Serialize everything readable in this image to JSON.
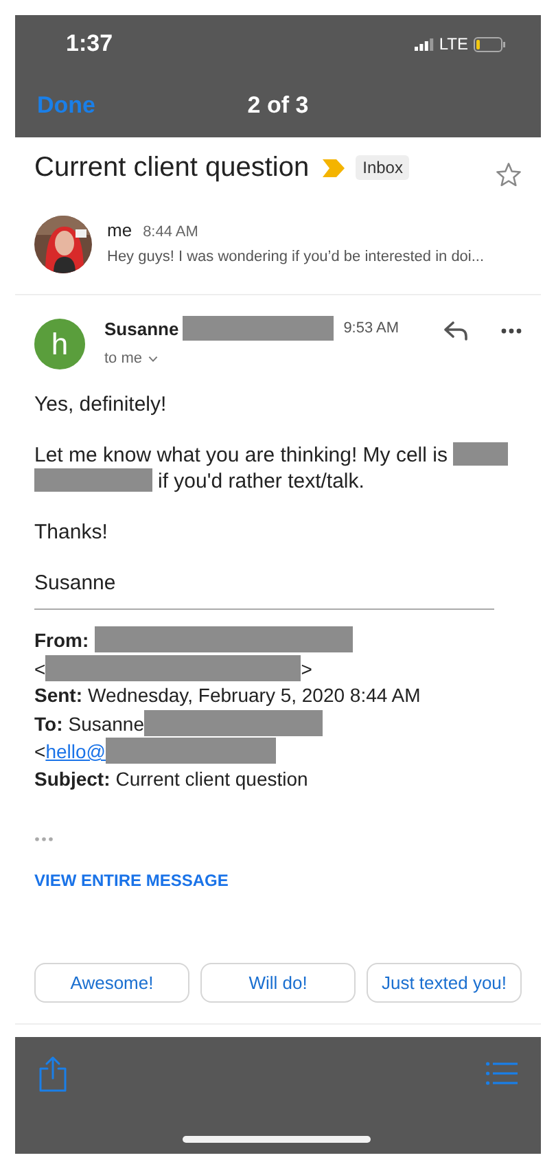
{
  "status_bar": {
    "time": "1:37",
    "network": "LTE"
  },
  "nav": {
    "done": "Done",
    "position": "2 of 3"
  },
  "thread": {
    "subject": "Current client question",
    "important": true,
    "label": "Inbox",
    "starred": false
  },
  "messages": [
    {
      "kind": "collapsed",
      "sender": "me",
      "time": "8:44 AM",
      "snippet": "Hey guys! I was wondering if you’d be interested in doi..."
    },
    {
      "kind": "expanded",
      "sender": "Susanne",
      "avatar_letter": "h",
      "color": "#5a9e3c",
      "time": "9:53 AM",
      "recipient": "to me",
      "body": [
        [
          {
            "kind": "text",
            "text": "Yes, definitely!"
          }
        ],
        [
          {
            "kind": "text",
            "text": "Let me know what you are thinking!  My cell is"
          },
          {
            "kind": "redacted"
          },
          {
            "kind": "redacted"
          },
          {
            "kind": "text",
            "text": "if you'd rather text/talk."
          }
        ],
        [
          {
            "kind": "text",
            "text": "Thanks!"
          }
        ],
        [
          {
            "kind": "text",
            "text": "Susanne"
          }
        ]
      ],
      "quoted": [
        [
          {
            "kind": "label",
            "text": "From:"
          },
          {
            "kind": "redacted"
          }
        ],
        [
          {
            "kind": "text",
            "text": "<"
          },
          {
            "kind": "redacted"
          },
          {
            "kind": "text",
            "text": ">"
          }
        ],
        [
          {
            "kind": "label",
            "text": "Sent:"
          },
          {
            "kind": "text",
            "text": "Wednesday, February 5, 2020 8:44 AM"
          }
        ],
        [
          {
            "kind": "label",
            "text": "To:"
          },
          {
            "kind": "text",
            "text": "Susanne"
          },
          {
            "kind": "redacted"
          }
        ],
        [
          {
            "kind": "text",
            "text": "<"
          },
          {
            "kind": "link",
            "text": "hello@"
          },
          {
            "kind": "redacted"
          }
        ],
        [
          {
            "kind": "label",
            "text": "Subject:"
          },
          {
            "kind": "text",
            "text": "Current client question"
          }
        ]
      ],
      "view_entire": "VIEW ENTIRE MESSAGE"
    }
  ],
  "smart_replies": [
    "Awesome!",
    "Will do!",
    "Just texted you!"
  ]
}
